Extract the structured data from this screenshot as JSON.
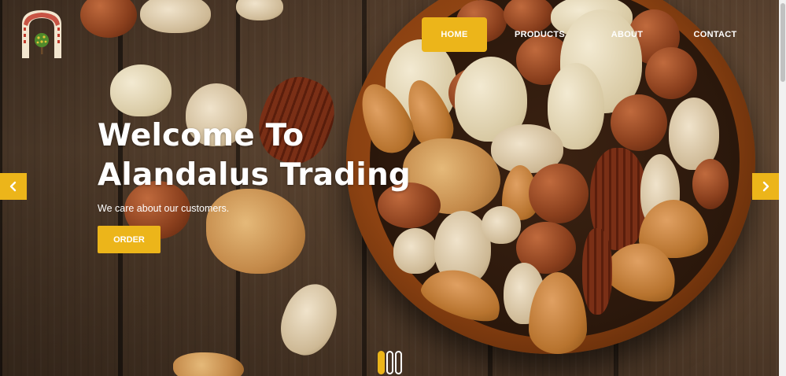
{
  "brand": {
    "logo_icon": "arch-with-tree-logo"
  },
  "nav": {
    "items": [
      {
        "label": "HOME",
        "active": true
      },
      {
        "label": "PRODUCTS",
        "active": false
      },
      {
        "label": "ABOUT",
        "active": false
      },
      {
        "label": "CONTACT",
        "active": false
      }
    ]
  },
  "hero": {
    "headline_line1": "Welcome To",
    "headline_line2": "Alandalus Trading",
    "tagline": "We care about our customers.",
    "cta_label": "ORDER"
  },
  "carousel": {
    "prev_icon": "chevron-left-icon",
    "next_icon": "chevron-right-icon",
    "slide_count": 3,
    "active_slide": 1
  },
  "colors": {
    "accent": "#ecb51a",
    "text": "#ffffff"
  }
}
